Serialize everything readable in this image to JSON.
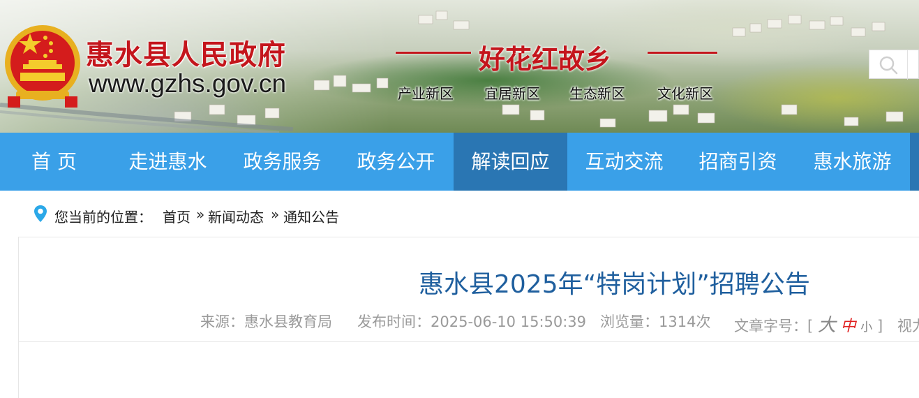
{
  "header": {
    "site_title": "惠水县人民政府",
    "site_domain": "www.gzhs.gov.cn",
    "slogan": "好花红故乡",
    "zones": [
      "产业新区",
      "宜居新区",
      "生态新区",
      "文化新区"
    ]
  },
  "nav": {
    "items": [
      "首 页",
      "走进惠水",
      "政务服务",
      "政务公开",
      "解读回应",
      "互动交流",
      "招商引资",
      "惠水旅游"
    ],
    "active_index": 4
  },
  "breadcrumb": {
    "label": "您当前的位置：",
    "items": [
      "首页",
      "新闻动态",
      "通知公告"
    ],
    "separator": "»"
  },
  "article": {
    "title": "惠水县2025年“特岗计划”招聘公告",
    "source": "来源：惠水县教育局",
    "published": "发布时间：2025-06-10 15:50:39",
    "views": "浏览量：1314次",
    "font_size_label": "文章字号：",
    "font_size_open": "[",
    "font_size_large": "大",
    "font_size_medium": "中",
    "font_size_small": "小",
    "font_size_close": "]",
    "vision_label": "视力"
  },
  "colors": {
    "brand_red": "#c4151c",
    "nav_blue": "#3aa0e8",
    "nav_active": "#2a76b3",
    "title_blue": "#1f5f9e"
  },
  "icons": {
    "emblem": "national-emblem",
    "search": "search-icon",
    "location": "location-pin-icon"
  }
}
